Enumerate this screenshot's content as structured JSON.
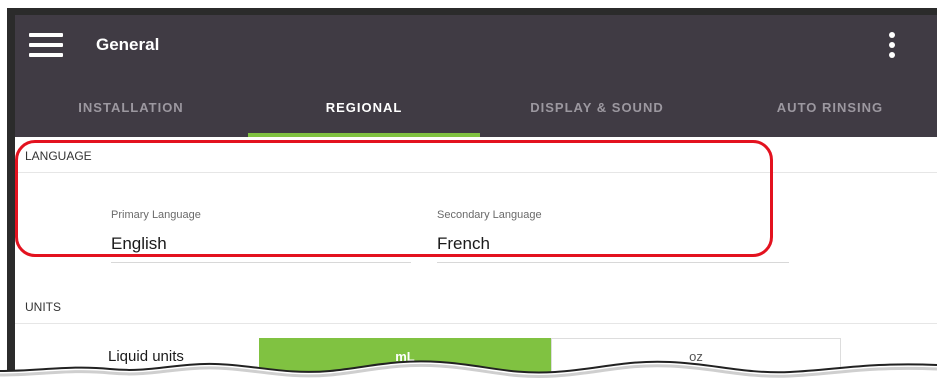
{
  "appbar": {
    "title": "General",
    "menu_icon": "hamburger-menu-icon",
    "overflow_icon": "more-vertical-icon"
  },
  "tabs": [
    {
      "label": "INSTALLATION",
      "active": false
    },
    {
      "label": "REGIONAL",
      "active": true
    },
    {
      "label": "DISPLAY & SOUND",
      "active": false
    },
    {
      "label": "AUTO RINSING",
      "active": false
    }
  ],
  "language": {
    "header": "LANGUAGE",
    "primary": {
      "label": "Primary Language",
      "value": "English"
    },
    "secondary": {
      "label": "Secondary Language",
      "value": "French"
    }
  },
  "units": {
    "header": "UNITS",
    "liquid": {
      "label": "Liquid units",
      "options": [
        "mL",
        "oz"
      ],
      "selected": "mL"
    }
  },
  "colors": {
    "appbar": "#403b44",
    "accent": "#80c241",
    "annotation": "#e3121f"
  }
}
